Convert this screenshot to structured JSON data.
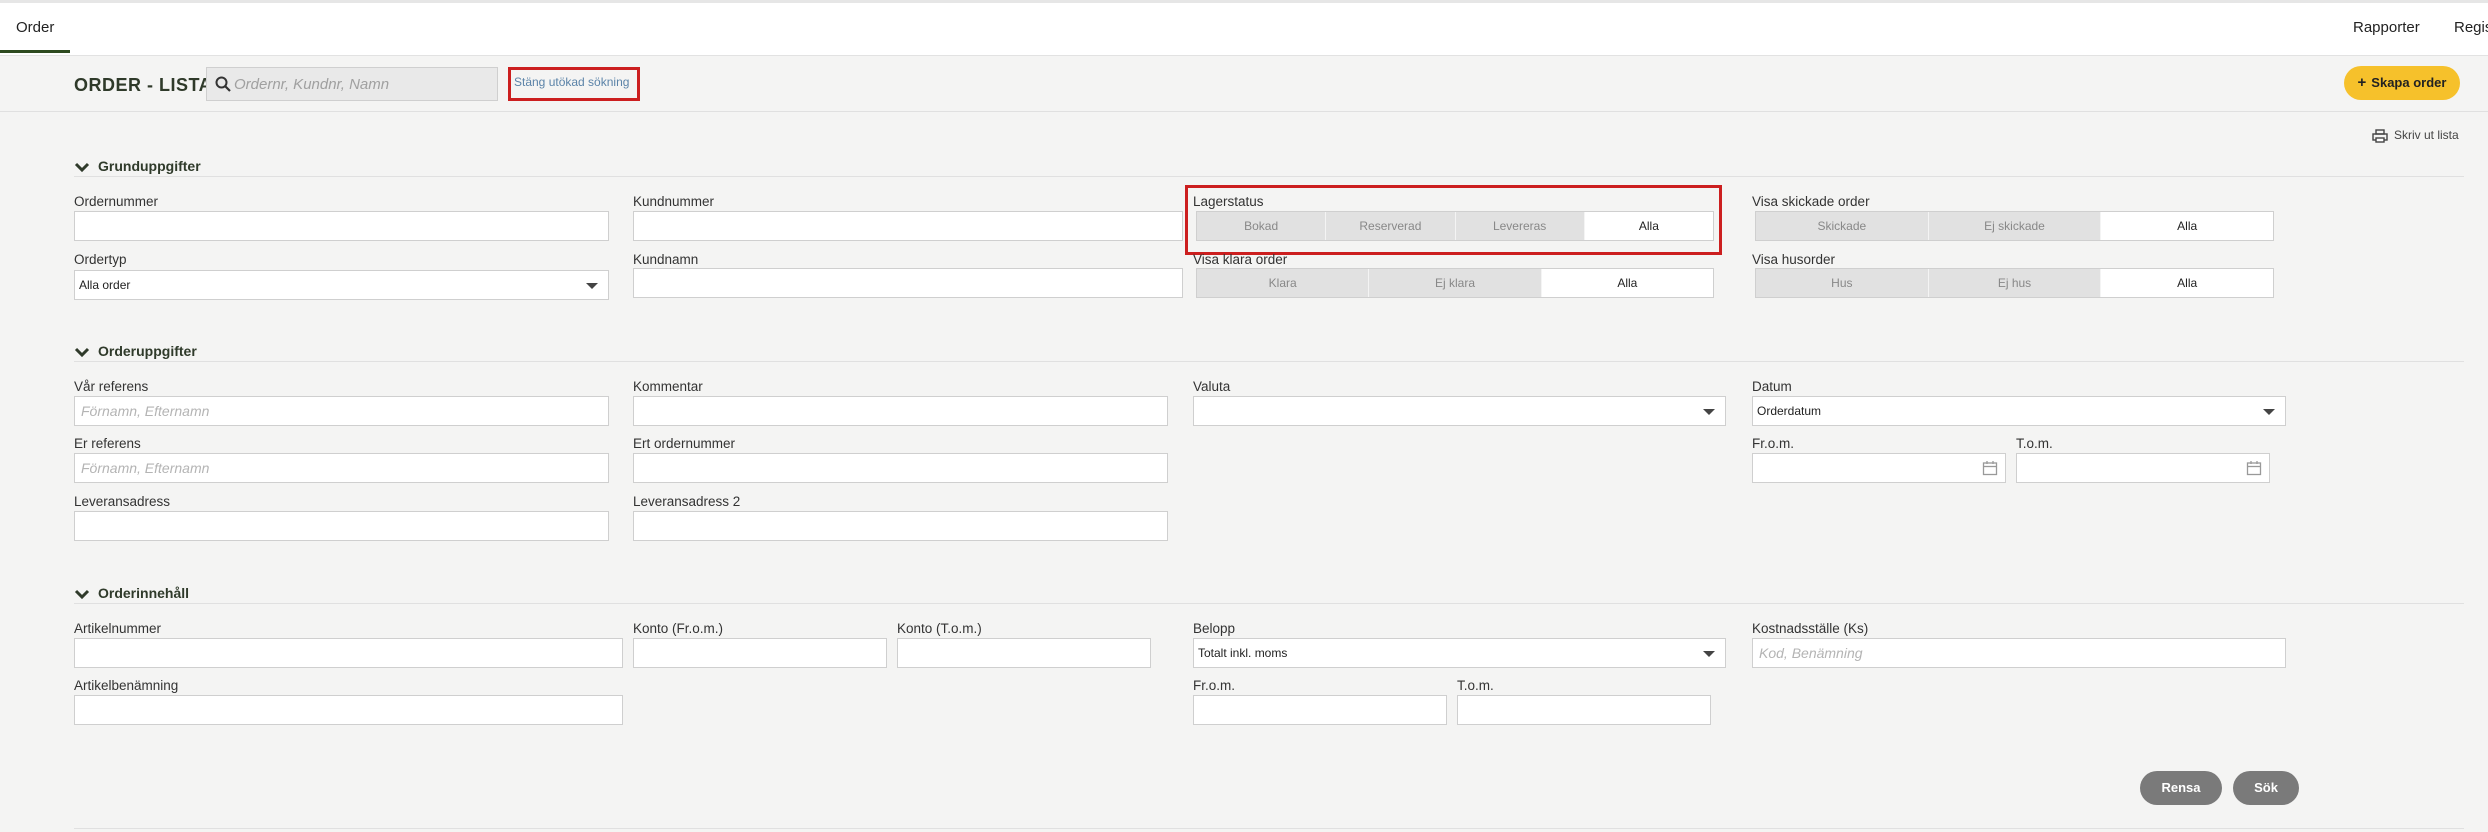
{
  "nav": {
    "order_tab": "Order",
    "rapporter": "Rapporter",
    "regis": "Regis"
  },
  "header": {
    "title": "ORDER - LISTA",
    "search_placeholder": "Ordernr, Kundnr, Namn",
    "close_advanced": "Stäng utökad sökning",
    "create_order": "Skapa order",
    "print_list": "Skriv ut lista"
  },
  "basic": {
    "title": "Grunduppgifter",
    "ordernummer": "Ordernummer",
    "kundnummer": "Kundnummer",
    "lagerstatus": "Lagerstatus",
    "lagerstatus_options": [
      "Bokad",
      "Reserverad",
      "Levereras",
      "Alla"
    ],
    "visa_skickade": "Visa skickade order",
    "skickade_options": [
      "Skickade",
      "Ej skickade",
      "Alla"
    ],
    "ordertyp": "Ordertyp",
    "ordertyp_value": "Alla order",
    "kundnamn": "Kundnamn",
    "visa_klara": "Visa klara order",
    "klara_options": [
      "Klara",
      "Ej klara",
      "Alla"
    ],
    "visa_husorder": "Visa husorder",
    "hus_options": [
      "Hus",
      "Ej hus",
      "Alla"
    ]
  },
  "orderinfo": {
    "title": "Orderuppgifter",
    "var_referens": "Vår referens",
    "var_referens_placeholder": "Förnamn, Efternamn",
    "kommentar": "Kommentar",
    "valuta": "Valuta",
    "datum": "Datum",
    "datum_value": "Orderdatum",
    "er_referens": "Er referens",
    "er_referens_placeholder": "Förnamn, Efternamn",
    "ert_ordernummer": "Ert ordernummer",
    "from": "Fr.o.m.",
    "tom": "T.o.m.",
    "leveransadress": "Leveransadress",
    "leveransadress2": "Leveransadress 2"
  },
  "content": {
    "title": "Orderinnehåll",
    "artikelnummer": "Artikelnummer",
    "konto_from": "Konto (Fr.o.m.)",
    "konto_tom": "Konto (T.o.m.)",
    "belopp": "Belopp",
    "belopp_value": "Totalt inkl. moms",
    "kostnadsstalle": "Kostnadsställe (Ks)",
    "kostnadsstalle_placeholder": "Kod, Benämning",
    "artikelbenamning": "Artikelbenämning",
    "from": "Fr.o.m.",
    "tom": "T.o.m."
  },
  "actions": {
    "rensa": "Rensa",
    "sok": "Sök"
  },
  "colors": {
    "accent": "#f6c12b",
    "highlight": "#cc1f1f",
    "nav_active": "#2d4a1f"
  }
}
